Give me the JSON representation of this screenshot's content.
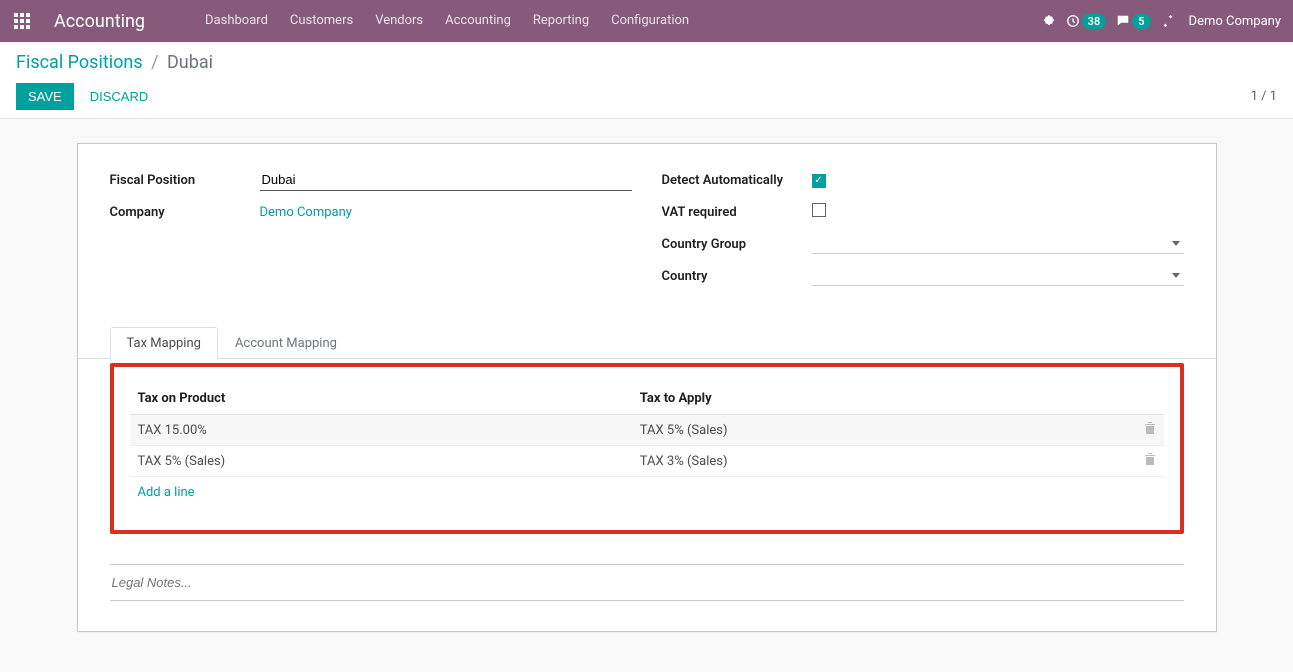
{
  "topbar": {
    "app_title": "Accounting",
    "menu": [
      "Dashboard",
      "Customers",
      "Vendors",
      "Accounting",
      "Reporting",
      "Configuration"
    ],
    "activities_count": "38",
    "messages_count": "5",
    "company": "Demo Company"
  },
  "breadcrumb": {
    "parent": "Fiscal Positions",
    "current": "Dubai"
  },
  "buttons": {
    "save": "SAVE",
    "discard": "DISCARD"
  },
  "pager": "1 / 1",
  "form": {
    "left": {
      "fiscal_position_label": "Fiscal Position",
      "fiscal_position_value": "Dubai",
      "company_label": "Company",
      "company_value": "Demo Company"
    },
    "right": {
      "detect_label": "Detect Automatically",
      "detect_checked": true,
      "vat_label": "VAT required",
      "vat_checked": false,
      "country_group_label": "Country Group",
      "country_label": "Country"
    }
  },
  "tabs": {
    "tax_mapping": "Tax Mapping",
    "account_mapping": "Account Mapping"
  },
  "tax_table": {
    "headers": {
      "product": "Tax on Product",
      "apply": "Tax to Apply"
    },
    "rows": [
      {
        "product": "TAX 15.00%",
        "apply": "TAX 5% (Sales)"
      },
      {
        "product": "TAX 5% (Sales)",
        "apply": "TAX 3% (Sales)"
      }
    ],
    "add_line": "Add a line"
  },
  "notes_placeholder": "Legal Notes..."
}
